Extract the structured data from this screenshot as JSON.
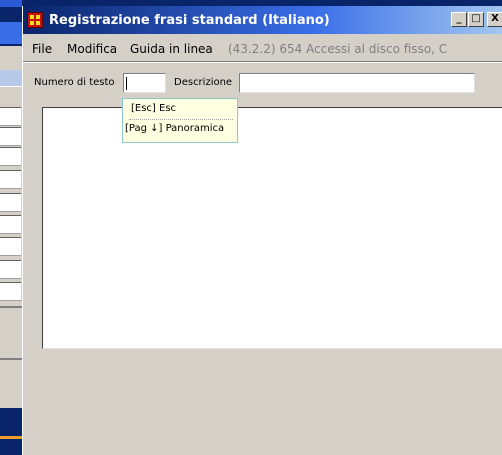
{
  "window": {
    "title": "Registrazione frasi standard (Italiano)",
    "minimize": "_",
    "maximize": "□",
    "close": "X"
  },
  "menu": {
    "items": [
      "File",
      "Modifica",
      "Guida in linea"
    ],
    "status": "(43.2.2) 654 Accessi al disco fisso, C"
  },
  "form": {
    "text_number_label": "Numero di testo",
    "text_number_value": "",
    "description_label": "Descrizione",
    "description_value": ""
  },
  "tooltip": {
    "line1": "[Esc]  Esc",
    "line2": "[Pag ↓] Panoramica"
  },
  "colors": {
    "titlebar_start": "#0a246a",
    "titlebar_end": "#a6caf0",
    "face": "#d4d0c8",
    "tooltip_bg": "#ffffe1"
  }
}
